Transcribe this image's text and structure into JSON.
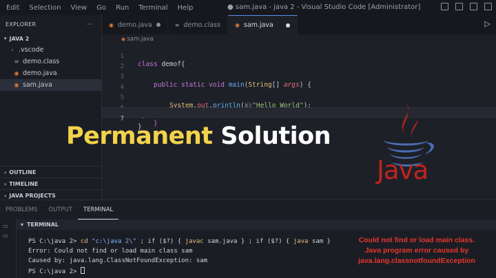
{
  "titlebar": {
    "menu": [
      "Edit",
      "Selection",
      "View",
      "Go",
      "Run",
      "Terminal",
      "Help"
    ],
    "window_title": "● sam.java - java 2 - Visual Studio Code [Administrator]"
  },
  "sidebar": {
    "header": "EXPLORER",
    "more": "···",
    "project": "JAVA 2",
    "items": [
      {
        "label": ".vscode",
        "icon": "chevron-right-icon"
      },
      {
        "label": "demo.class",
        "icon": "file-icon"
      },
      {
        "label": "demo.java",
        "icon": "java-file-icon"
      },
      {
        "label": "sam.java",
        "icon": "java-file-icon"
      }
    ],
    "sections": [
      "OUTLINE",
      "TIMELINE",
      "JAVA PROJECTS"
    ]
  },
  "tabs": [
    {
      "label": "demo.java",
      "modified": true,
      "active": false,
      "italic": false
    },
    {
      "label": "demo.class",
      "modified": false,
      "active": false,
      "italic": true
    },
    {
      "label": "sam.java",
      "modified": true,
      "active": true,
      "italic": false
    }
  ],
  "editor": {
    "breadcrumb": "sam.java",
    "line_numbers": [
      "1",
      "2",
      "3",
      "4",
      "5",
      "6",
      "7"
    ],
    "code": {
      "l1_kw": "class",
      "l1_name": " demof{",
      "l3_mods": "public static ",
      "l3_type": "void",
      "l3_fn": " main",
      "l3_open": "(",
      "l3_ptype": "String",
      "l3_brackets": "[] ",
      "l3_pname": "args",
      "l3_close": ") {",
      "l5_sys": "System",
      "l5_dot1": ".",
      "l5_out": "out",
      "l5_dot2": ".",
      "l5_fn": "println",
      "l5_open": "(",
      "l5_hint": "x:",
      "l5_str": "\"Hello World\"",
      "l5_close": ");",
      "l6_brace": "}",
      "l7_brace": "}"
    }
  },
  "overlay": {
    "title_part1": "Permanent",
    "title_part2": " Solution",
    "logo_text": "Java"
  },
  "panel": {
    "tabs": [
      "PROBLEMS",
      "OUTPUT",
      "TERMINAL"
    ],
    "terminal_header": "TERMINAL",
    "lines": {
      "l1_prompt": "PS C:\\java 2> ",
      "l1_cd": "cd",
      "l1_path": " \"c:\\java 2\\\"",
      "l1_rest1": " ; if ($?) { ",
      "l1_javac": "javac",
      "l1_rest2": " sam.java } ; if ($?) { ",
      "l1_java": "java",
      "l1_rest3": " sam }",
      "l2": "Error: Could not find or load main class sam",
      "l3": "Caused by: java.lang.ClassNotFoundException: sam",
      "l4_prompt": "PS C:\\java 2> "
    },
    "error_note": [
      "Could not find or load main class.",
      "Java program error caused by",
      "java.lang.classnotfoundException"
    ]
  },
  "colors": {
    "accent_yellow": "#f3d34a",
    "java_red": "#c2231f",
    "java_blue": "#4b6fb5",
    "error_red": "#e8352b"
  }
}
